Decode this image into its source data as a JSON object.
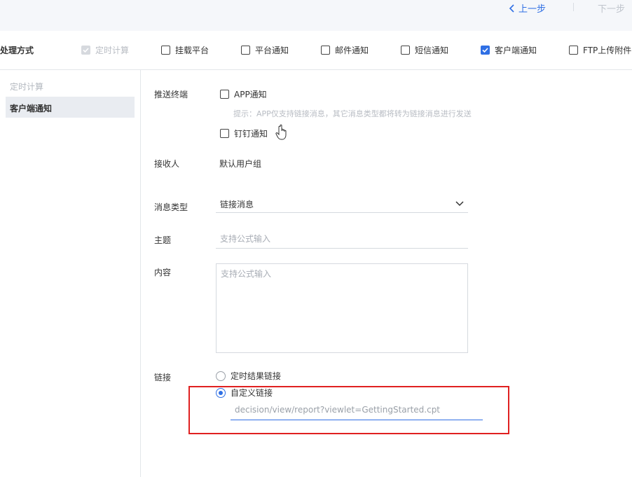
{
  "nav": {
    "prev_label": "上一步",
    "next_label": "下一步"
  },
  "method": {
    "title": "处理方式",
    "options": [
      {
        "label": "定时计算",
        "checked": true,
        "disabled": true
      },
      {
        "label": "挂载平台",
        "checked": false
      },
      {
        "label": "平台通知",
        "checked": false
      },
      {
        "label": "邮件通知",
        "checked": false
      },
      {
        "label": "短信通知",
        "checked": false
      },
      {
        "label": "客户端通知",
        "checked": true
      },
      {
        "label": "FTP上传附件",
        "checked": false
      }
    ]
  },
  "sidebar": {
    "items": [
      {
        "label": "定时计算",
        "active": false
      },
      {
        "label": "客户端通知",
        "active": true
      }
    ]
  },
  "form": {
    "push_terminal": {
      "label": "推送终端",
      "app_label": "APP通知",
      "app_checked": false,
      "hint": "提示：APP仅支持链接消息，其它消息类型都将转为链接消息进行发送",
      "dingtalk_label": "钉钉通知",
      "dingtalk_checked": false
    },
    "recipient": {
      "label": "接收人",
      "value": "默认用户组"
    },
    "message_type": {
      "label": "消息类型",
      "value": "链接消息"
    },
    "subject": {
      "label": "主题",
      "placeholder": "支持公式输入"
    },
    "content": {
      "label": "内容",
      "placeholder": "支持公式输入"
    },
    "link": {
      "label": "链接",
      "option_scheduled": "定时结果链接",
      "option_custom": "自定义链接",
      "selected": "custom",
      "custom_value": "decision/view/report?viewlet=GettingStarted.cpt"
    }
  },
  "colors": {
    "accent": "#2f6fe4",
    "highlight": "#e02020"
  }
}
